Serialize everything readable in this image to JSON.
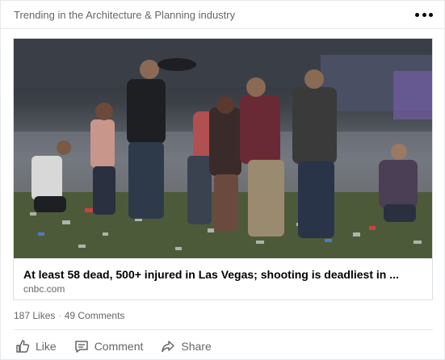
{
  "header": {
    "text": "Trending in the Architecture & Planning industry",
    "more_icon": "more-dots-icon"
  },
  "article": {
    "title": "At least 58 dead, 500+ injured in Las Vegas; shooting is deadliest in ...",
    "source": "cnbc.com"
  },
  "stats": {
    "likes": "187 Likes",
    "separator": "·",
    "comments": "49 Comments"
  },
  "actions": [
    {
      "label": "Like",
      "icon": "thumbs-up-icon"
    },
    {
      "label": "Comment",
      "icon": "comment-icon"
    },
    {
      "label": "Share",
      "icon": "share-arrow-icon"
    }
  ],
  "colors": {
    "text_primary": "#000000",
    "text_secondary": "#666666",
    "border": "#e6e9ec"
  }
}
